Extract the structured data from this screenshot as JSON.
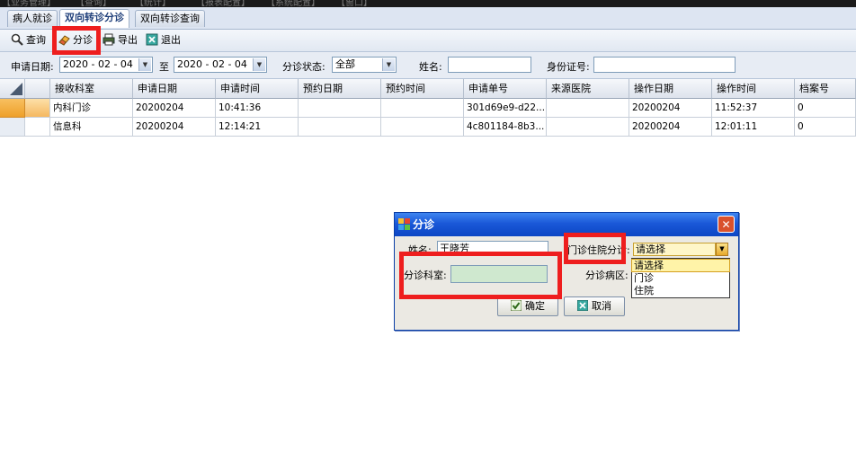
{
  "menubar": {
    "items": [
      "【业务管理】",
      "【查询】",
      "【统计】",
      "【报表配置】",
      "【系统配置】",
      "【窗口】"
    ]
  },
  "tabs": [
    {
      "label": "病人就诊",
      "active": false
    },
    {
      "label": "双向转诊分诊",
      "active": true
    },
    {
      "label": "双向转诊查询",
      "active": false
    }
  ],
  "toolbar": {
    "query_label": "查询",
    "triage_label": "分诊",
    "export_label": "导出",
    "exit_label": "退出"
  },
  "filter": {
    "apply_date_label": "申请日期:",
    "date_from": "2020 - 02 - 04",
    "to_label": "至",
    "date_to": "2020 - 02 - 04",
    "status_label": "分诊状态:",
    "status_value": "全部",
    "name_label": "姓名:",
    "name_value": "",
    "idcard_label": "身份证号:",
    "idcard_value": ""
  },
  "grid": {
    "columns": [
      "接收科室",
      "申请日期",
      "申请时间",
      "预约日期",
      "预约时间",
      "申请单号",
      "来源医院",
      "操作日期",
      "操作时间",
      "档案号"
    ],
    "rows": [
      [
        "内科门诊",
        "20200204",
        "10:41:36",
        "",
        "",
        "301d69e9-d22...",
        "",
        "20200204",
        "11:52:37",
        "0"
      ],
      [
        "信息科",
        "20200204",
        "12:14:21",
        "",
        "",
        "4c801184-8b3...",
        "",
        "20200204",
        "12:01:11",
        "0"
      ]
    ]
  },
  "dialog": {
    "title": "分诊",
    "name_label": "姓名:",
    "name_value": "王晓芳",
    "type_label": "门诊住院分诊:",
    "type_value": "请选择",
    "dept_label": "分诊科室:",
    "dept_value": "",
    "ward_label": "分诊病区:",
    "confirm_label": "确定",
    "cancel_label": "取消",
    "dropdown_options": [
      "请选择",
      "门诊",
      "住院"
    ],
    "dropdown_selected": "请选择"
  },
  "colors": {
    "highlight_red": "#ee1e1e",
    "title_blue": "#1a58d8",
    "field_green": "#cfe8cf",
    "row_selected_orange": "#f5a030"
  }
}
